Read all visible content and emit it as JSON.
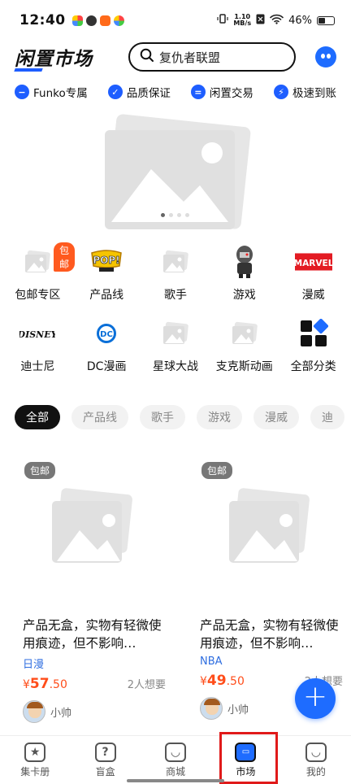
{
  "status_bar": {
    "time": "12:40",
    "net_speed_value": "1.10",
    "net_speed_unit": "MB/s",
    "battery": "46%"
  },
  "header": {
    "logo": "闲置市场",
    "search_placeholder": "复仇者联盟"
  },
  "features": [
    {
      "label": "Funko专属",
      "icon": "minus-badge-icon"
    },
    {
      "label": "品质保证",
      "icon": "check-badge-icon"
    },
    {
      "label": "闲置交易",
      "icon": "swap-badge-icon"
    },
    {
      "label": "极速到账",
      "icon": "lightning-badge-icon"
    }
  ],
  "banner": {
    "slide_count": 4,
    "active_slide": 1
  },
  "categories": [
    {
      "label": "包邮专区",
      "badge": "包邮",
      "icon": "placeholder-image-icon"
    },
    {
      "label": "产品线",
      "icon": "funko-pop-logo-icon"
    },
    {
      "label": "歌手",
      "icon": "placeholder-image-icon"
    },
    {
      "label": "游戏",
      "icon": "figure-icon"
    },
    {
      "label": "漫威",
      "icon": "marvel-logo-icon",
      "logo_text": "MARVEL"
    },
    {
      "label": "迪士尼",
      "icon": "disney-logo-icon",
      "logo_text": "DISNEY"
    },
    {
      "label": "DC漫画",
      "icon": "dc-logo-icon",
      "logo_text": "DC"
    },
    {
      "label": "星球大战",
      "icon": "placeholder-image-icon"
    },
    {
      "label": "支克斯动画",
      "icon": "placeholder-image-icon"
    },
    {
      "label": "全部分类",
      "icon": "grid-icon"
    }
  ],
  "chips": [
    "全部",
    "产品线",
    "歌手",
    "游戏",
    "漫威",
    "迪"
  ],
  "products": [
    {
      "tag": "包邮",
      "title": "产品无盒，实物有轻微使用痕迹，但不影响…",
      "category": "日漫",
      "price_symbol": "¥",
      "price_int": "57",
      "price_dec": ".50",
      "want": "2人想要",
      "seller": "小帅"
    },
    {
      "tag": "包邮",
      "title": "产品无盒，实物有轻微使用痕迹，但不影响…",
      "category": "NBA",
      "price_symbol": "¥",
      "price_int": "49",
      "price_dec": ".50",
      "want": "2人想要",
      "seller": "小帅"
    }
  ],
  "fab": {
    "label": "+"
  },
  "bottom_nav": [
    {
      "label": "集卡册",
      "glyph": "★"
    },
    {
      "label": "盲盒",
      "glyph": "?"
    },
    {
      "label": "商城",
      "glyph": "◡"
    },
    {
      "label": "市场",
      "glyph": "▭"
    },
    {
      "label": "我的",
      "glyph": "◡"
    }
  ],
  "colors": {
    "accent": "#1e6cff",
    "price": "#ff4d1a",
    "badge": "#ff5a1f",
    "highlight": "#e01a1a"
  }
}
